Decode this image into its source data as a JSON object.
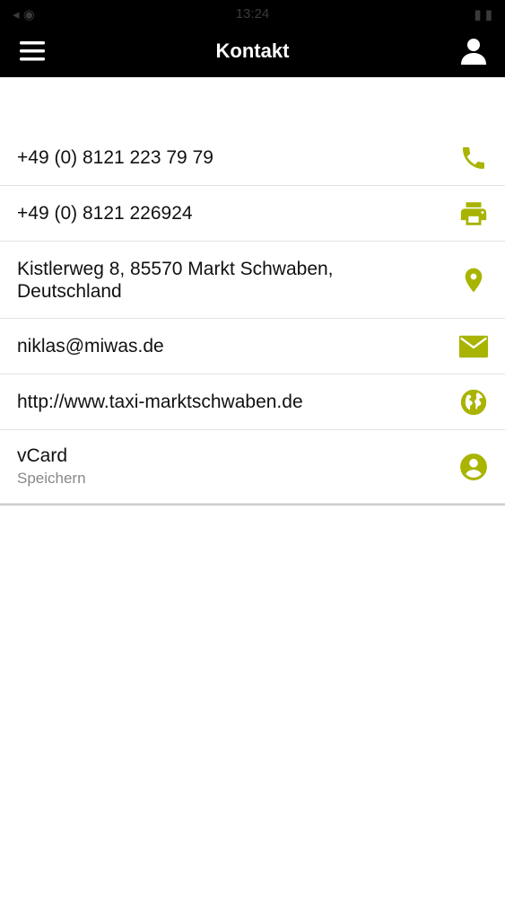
{
  "status_bar": {
    "time": "13:24",
    "left": "◂ ◉",
    "right": "▮ ▮"
  },
  "nav": {
    "title": "Kontakt",
    "menu_icon": "hamburger-menu-icon",
    "user_icon": "person-icon"
  },
  "contacts": {
    "phone": "+49 (0) 8121 223 79 79",
    "fax": "+49 (0) 8121 226924",
    "address_line1": "Kistlerweg 8, 85570 Markt Schwaben,",
    "address_line2": "Deutschland",
    "email": "niklas@miwas.de",
    "website": "http://www.taxi-marktschwaben.de",
    "vcard_title": "vCard",
    "vcard_subtitle": "Speichern"
  },
  "colors": {
    "accent": "#a8b400",
    "nav_bg": "#000000"
  }
}
